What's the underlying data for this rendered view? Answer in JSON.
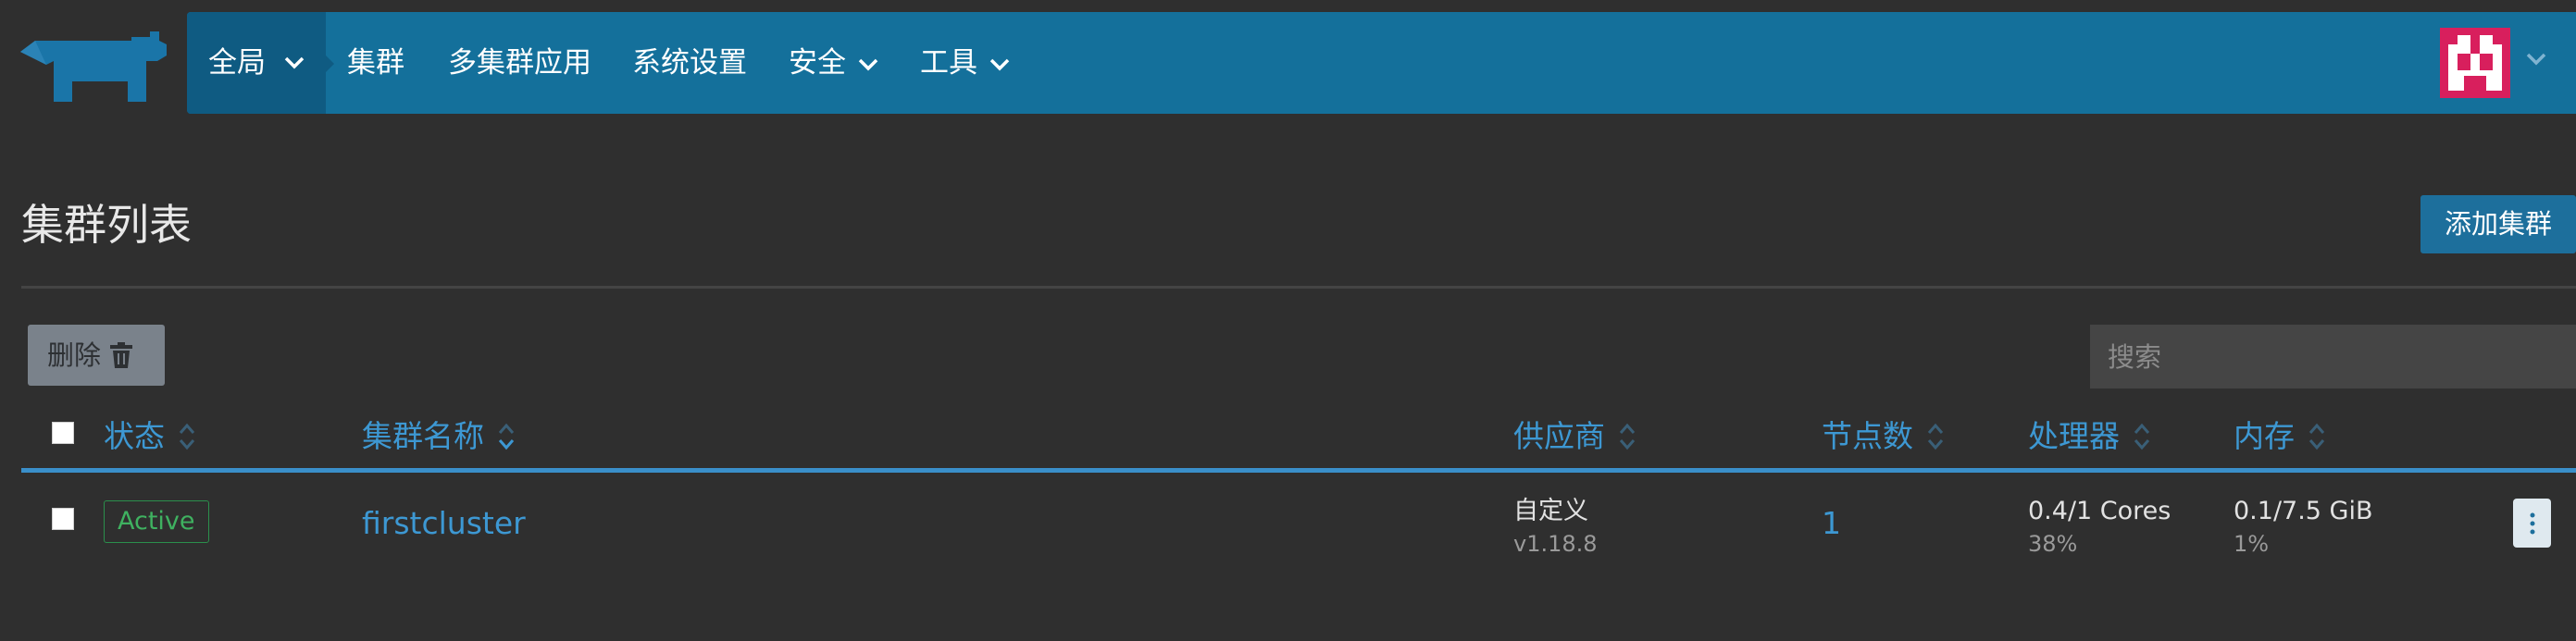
{
  "nav": {
    "global": "全局",
    "items": [
      {
        "label": "集群"
      },
      {
        "label": "多集群应用"
      },
      {
        "label": "系统设置"
      },
      {
        "label": "安全"
      },
      {
        "label": "工具"
      }
    ]
  },
  "page": {
    "title": "集群列表",
    "add_button": "添加集群"
  },
  "toolbar": {
    "delete_label": "删除",
    "search_placeholder": "搜索"
  },
  "table": {
    "headers": {
      "state": "状态",
      "name": "集群名称",
      "provider": "供应商",
      "nodes": "节点数",
      "cpu": "处理器",
      "memory": "内存"
    },
    "rows": [
      {
        "state": "Active",
        "name": "firstcluster",
        "provider": "自定义",
        "version": "v1.18.8",
        "nodes": "1",
        "cpu": "0.4/1 Cores",
        "cpu_pct": "38%",
        "memory": "0.1/7.5 GiB",
        "memory_pct": "1%"
      }
    ]
  },
  "colors": {
    "navbar": "#14709b",
    "accent": "#3d98d3",
    "active": "#3fb160",
    "avatar": "#d81f5d"
  }
}
